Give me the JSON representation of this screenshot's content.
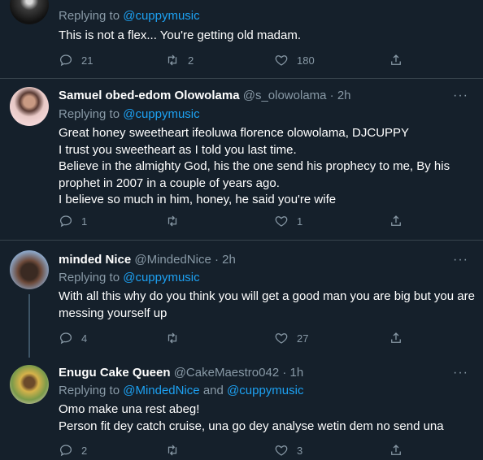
{
  "tweets": [
    {
      "replying_prefix": "Replying to ",
      "mention_1": "@cuppymusic",
      "body": "This is not a flex... You're getting old madam.",
      "actions": {
        "reply": "21",
        "retweet": "2",
        "like": "180"
      }
    },
    {
      "name": "Samuel obed-edom Olowolama",
      "handle": "@s_olowolama",
      "time": " · 2h",
      "more": "···",
      "replying_prefix": "Replying to ",
      "mention_1": "@cuppymusic",
      "body": "Great honey sweetheart ifeoluwa florence olowolama, DJCUPPY\nI trust you sweetheart as I told you last time.\nBelieve in the almighty God,  his the one send his prophecy to me, By his prophet in 2007 in a couple of years ago.\nI believe so much in him, honey, he said you're wife",
      "actions": {
        "reply": "1",
        "retweet": "",
        "like": "1"
      }
    },
    {
      "name": "minded Nice",
      "handle": "@MindedNice",
      "time": " · 2h",
      "more": "···",
      "replying_prefix": "Replying to ",
      "mention_1": "@cuppymusic",
      "body": "With all this why do you think you will get a good man you are big but you are messing yourself up",
      "actions": {
        "reply": "4",
        "retweet": "",
        "like": "27"
      }
    },
    {
      "name": "Enugu Cake Queen",
      "handle": "@CakeMaestro042",
      "time": " · 1h",
      "more": "···",
      "replying_prefix": "Replying to ",
      "mention_1": "@MindedNice",
      "mention_joiner": " and ",
      "mention_2": "@cuppymusic",
      "body": "Omo make una rest abeg!\nPerson fit dey catch cruise, una go dey analyse wetin dem no send una",
      "actions": {
        "reply": "2",
        "retweet": "",
        "like": "3"
      }
    }
  ],
  "colors": {
    "background": "#15202b",
    "muted": "#8899a6",
    "link": "#1da1f2",
    "divider": "#38444d"
  },
  "icons": [
    "reply-icon",
    "retweet-icon",
    "like-icon",
    "share-icon",
    "more-icon"
  ]
}
